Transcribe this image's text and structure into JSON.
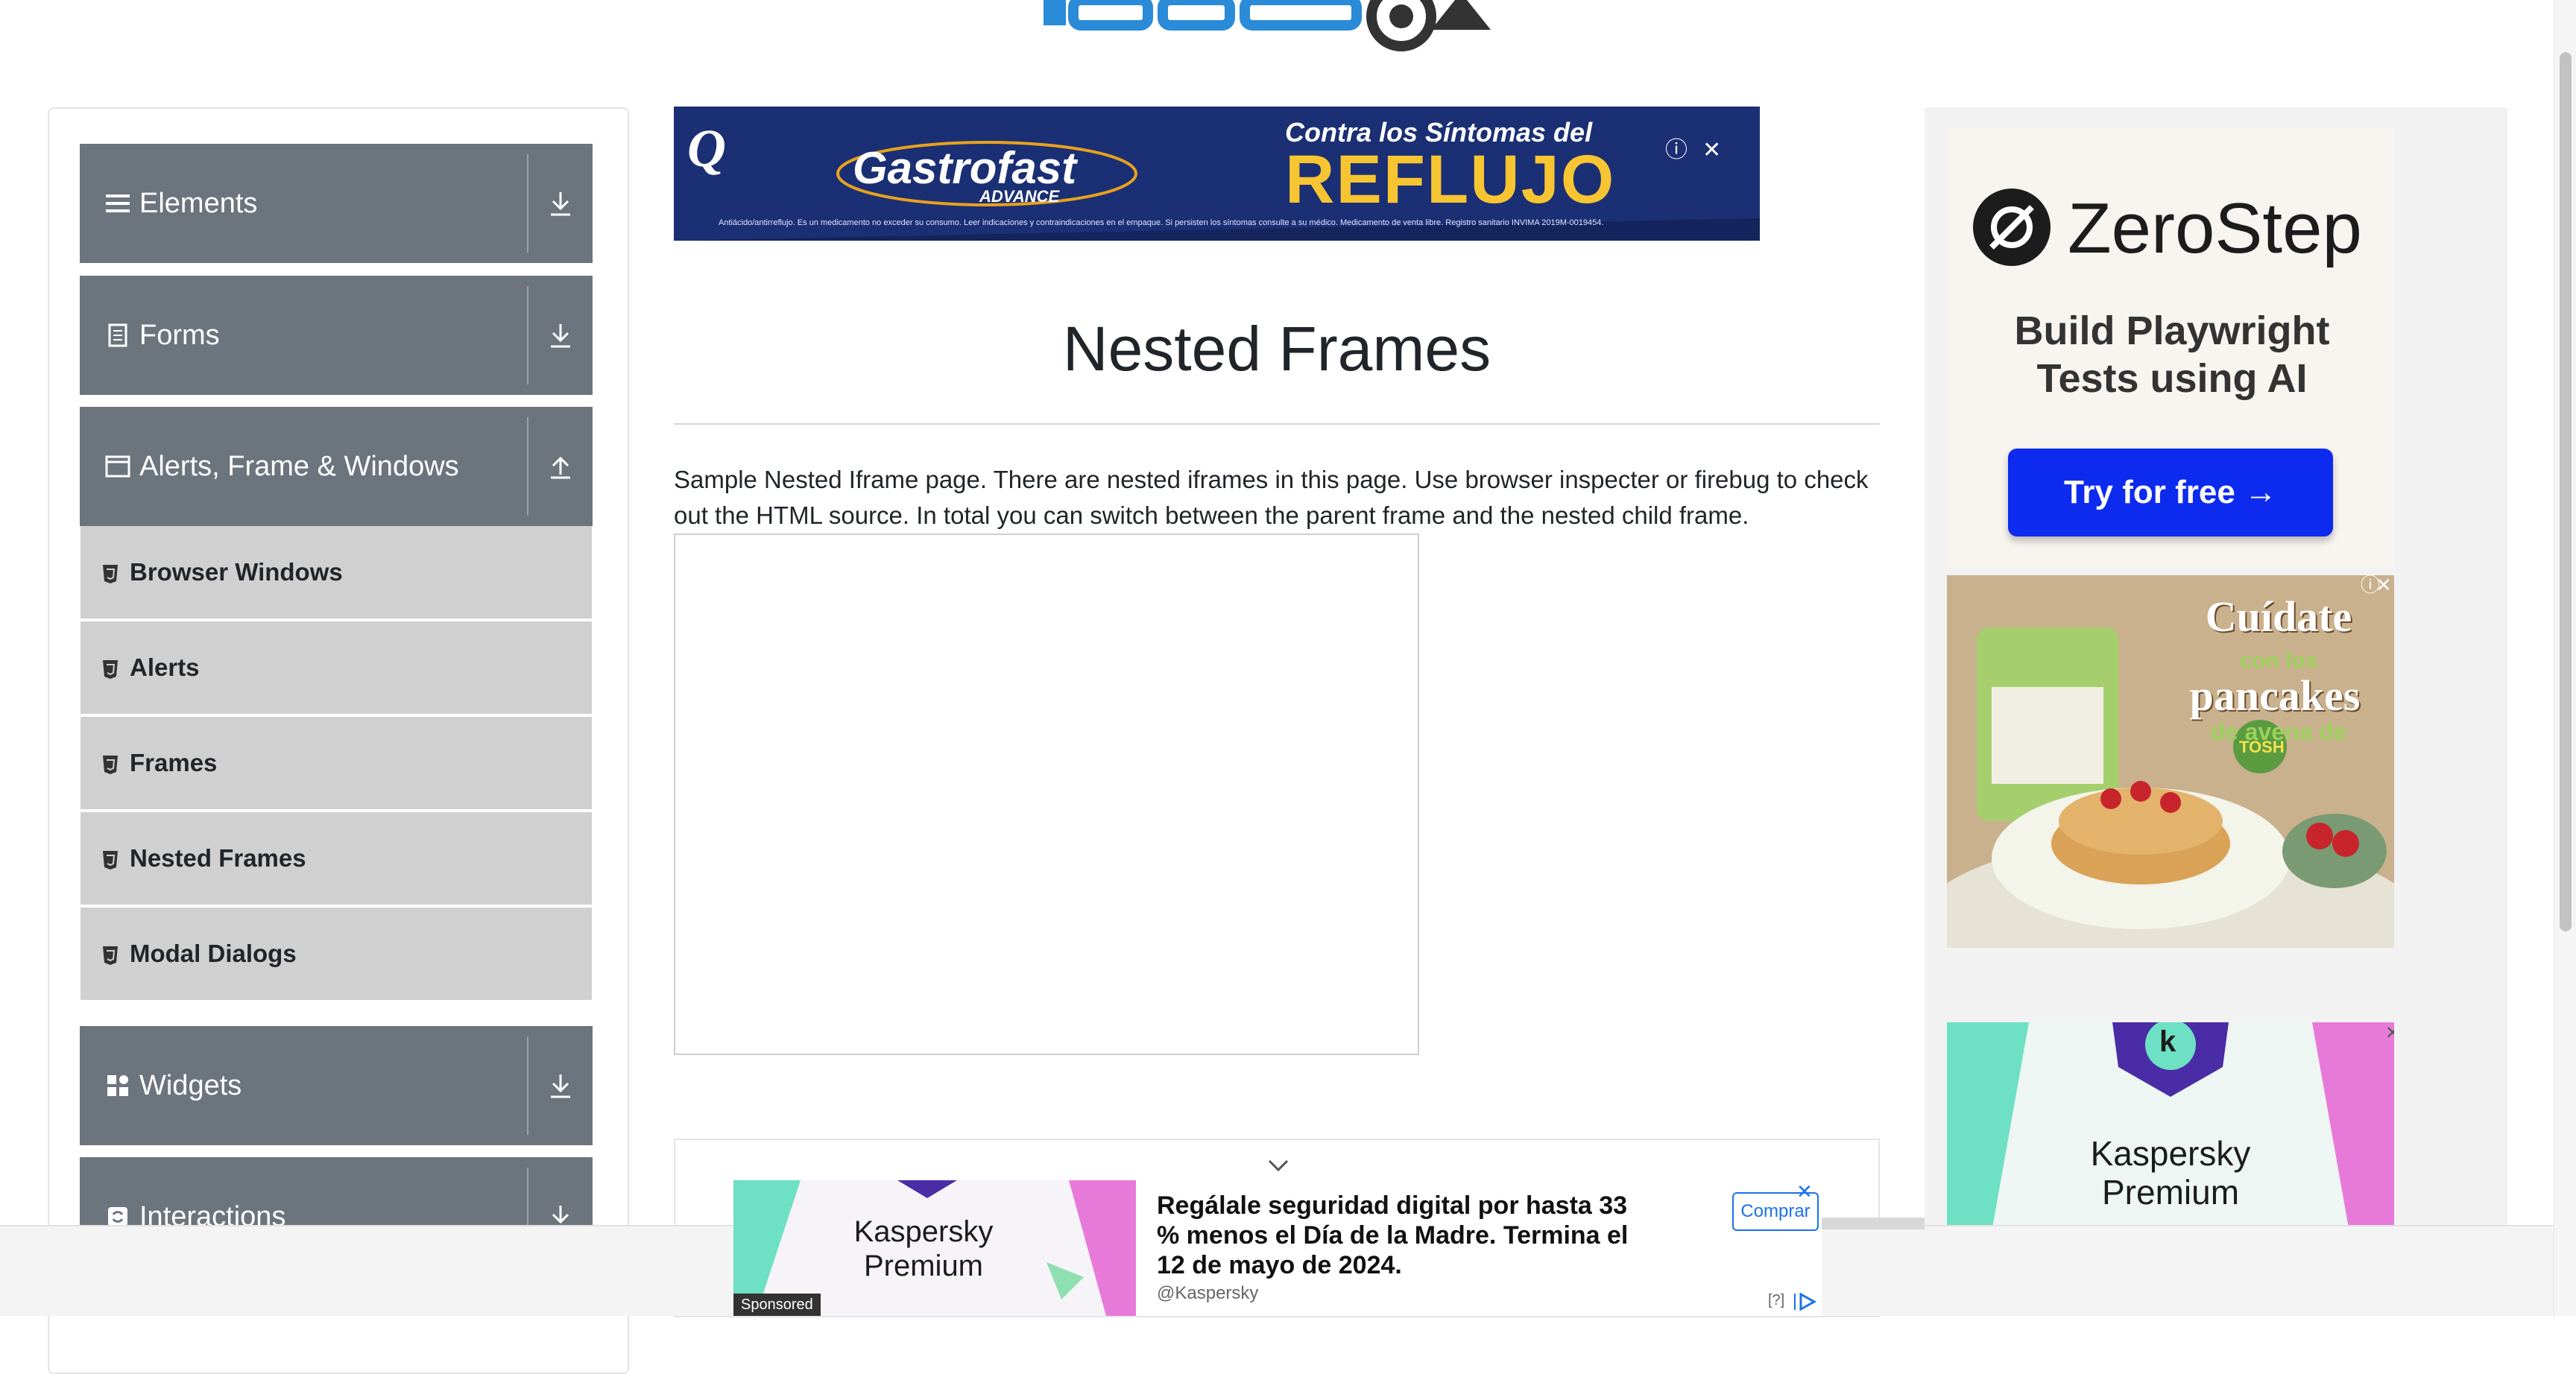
{
  "sidebar": {
    "groups": [
      {
        "label": "Elements",
        "icon": "hamburger-icon",
        "toggle": "download-icon"
      },
      {
        "label": "Forms",
        "icon": "document-icon",
        "toggle": "download-icon"
      },
      {
        "label": "Alerts, Frame & Windows",
        "icon": "window-icon",
        "toggle": "upload-icon"
      },
      {
        "label": "Widgets",
        "icon": "grid-icon",
        "toggle": "download-icon"
      },
      {
        "label": "Interactions",
        "icon": "cycle-icon",
        "toggle": "download-icon"
      }
    ],
    "alerts_items": [
      {
        "label": "Browser Windows"
      },
      {
        "label": "Alerts"
      },
      {
        "label": "Frames"
      },
      {
        "label": "Nested Frames"
      },
      {
        "label": "Modal Dialogs"
      }
    ]
  },
  "main": {
    "title": "Nested Frames",
    "description": "Sample Nested Iframe page. There are nested iframes in this page. Use browser inspecter or firebug to check out the HTML source. In total you can switch between the parent frame and the nested child frame."
  },
  "ads": {
    "top_banner": {
      "brand": "Gastrofast",
      "brand_sub": "ADVANCE",
      "headline_small": "Contra los Síntomas del",
      "headline_big": "REFLUJO",
      "fine_print": "Antiácido/antirreflujo. Es un medicamento no exceder su consumo. Leer indicaciones y contraindicaciones en el empaque. Si persisten los síntomas consulte a su médico. Medicamento de venta libre. Registro sanitario INVIMA 2019M-0019454."
    },
    "zerostep": {
      "brand": "ZeroStep",
      "tagline": "Build Playwright Tests using AI",
      "cta": "Try for free →"
    },
    "pancakes": {
      "line1": "Cuídate",
      "line2": "con los",
      "line3": "pancakes",
      "line4": "de avena de",
      "brand": "TOSH"
    },
    "kaspersky_side": {
      "product": "Kaspersky Premium",
      "logo_letter": "k"
    },
    "bottom_banner": {
      "product": "Kaspersky Premium",
      "headline": "Regálale seguridad digital por hasta 33 % menos el Día de la Madre. Termina el 12 de mayo de 2024.",
      "handle": "@Kaspersky",
      "cta": "Comprar",
      "sponsored": "Sponsored",
      "help": "[?]"
    }
  },
  "colors": {
    "sidebar_header_bg": "#6c757d",
    "menu_item_bg": "#d0d0d0",
    "zerostep_cta": "#0d2bef",
    "gastrofast_bg": "#1b2f74",
    "reflujo_yellow": "#f7c531"
  }
}
